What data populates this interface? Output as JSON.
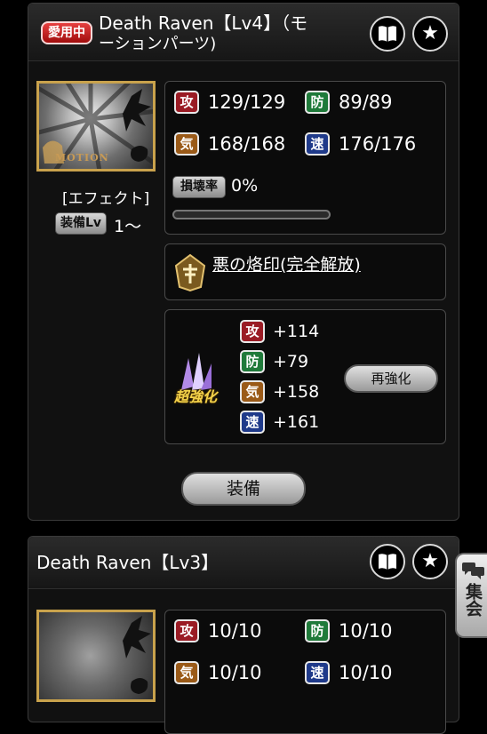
{
  "items": [
    {
      "in_use_label": "愛用中",
      "title_line1": "Death Raven【Lv4】（モ",
      "title_line2": "ーションパーツ)",
      "thumb_label": "MOTION",
      "effect_label": "[エフェクト]",
      "equip_lv_label": "装備Lv",
      "equip_lv_value": "1～",
      "stats": {
        "atk_label": "攻",
        "atk_value": "129/129",
        "def_label": "防",
        "def_value": "89/89",
        "spi_label": "気",
        "spi_value": "168/168",
        "spd_label": "速",
        "spd_value": "176/176"
      },
      "damage_label": "損壊率",
      "damage_value": "0%",
      "damage_fraction": 0,
      "skill_name": "悪の烙印(完全解放)",
      "super_label": "超強化",
      "bonus": {
        "atk": "+114",
        "def": "+79",
        "spi": "+158",
        "spd": "+161"
      },
      "reenhance_label": "再強化",
      "equip_label": "装備"
    },
    {
      "title": "Death Raven【Lv3】",
      "stats": {
        "atk_label": "攻",
        "atk_value": "10/10",
        "def_label": "防",
        "def_value": "10/10",
        "spi_label": "気",
        "spi_value": "10/10",
        "spd_label": "速",
        "spd_value": "10/10"
      }
    }
  ],
  "side_tab": {
    "label": "集会"
  }
}
